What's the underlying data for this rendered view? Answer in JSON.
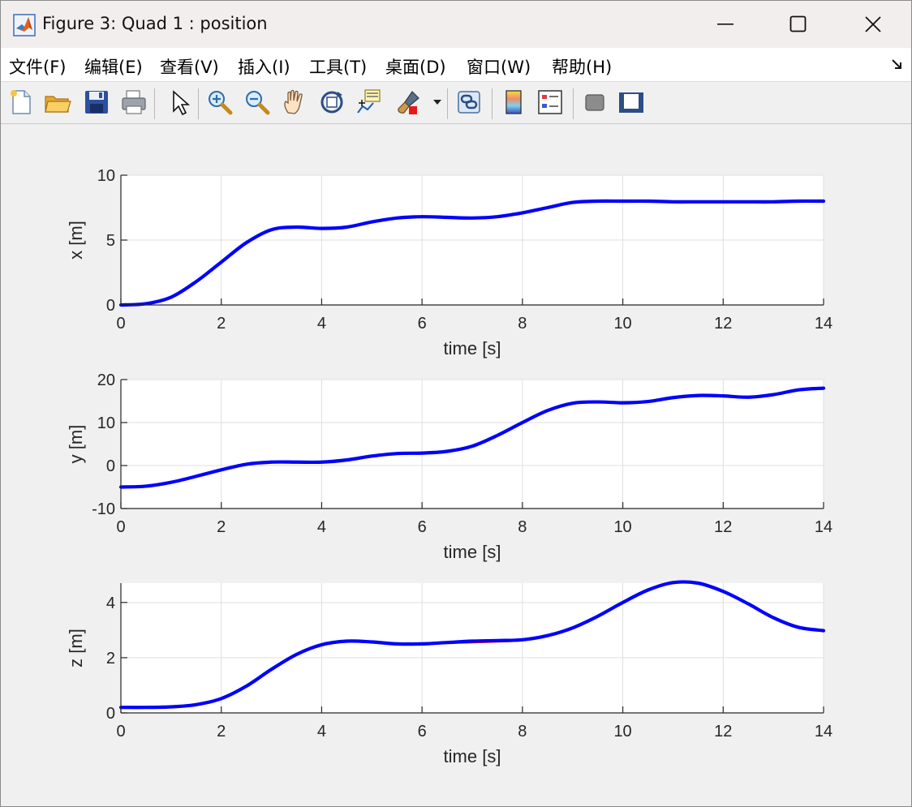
{
  "window": {
    "title": "Figure 3: Quad 1 : position",
    "app_icon": "matlab-logo-icon"
  },
  "menubar": {
    "items": [
      "文件(F)",
      "编辑(E)",
      "查看(V)",
      "插入(I)",
      "工具(T)",
      "桌面(D)",
      "窗口(W)",
      "帮助(H)"
    ]
  },
  "toolbar": {
    "buttons": [
      "new-figure-icon",
      "open-file-icon",
      "save-icon",
      "print-icon",
      "edit-plot-arrow-icon",
      "zoom-in-icon",
      "zoom-out-icon",
      "pan-hand-icon",
      "rotate-3d-icon",
      "data-cursor-icon",
      "brush-icon",
      "brush-dropdown-icon",
      "link-plot-icon",
      "colorbar-icon",
      "legend-icon",
      "hide-plot-tools-icon",
      "show-plot-tools-icon"
    ]
  },
  "colors": {
    "line_main": "#0000ff",
    "line_ref": "#ff0000",
    "axes_bg": "#ffffff",
    "figure_bg": "#f0f0f0"
  },
  "chart_data": [
    {
      "type": "line",
      "xlabel": "time [s]",
      "ylabel": "x [m]",
      "xlim": [
        0,
        14
      ],
      "ylim": [
        0,
        10
      ],
      "xticks": [
        "0",
        "2",
        "4",
        "6",
        "8",
        "10",
        "12",
        "14"
      ],
      "yticks": [
        "0",
        "5",
        "10"
      ],
      "grid": true,
      "series": [
        {
          "color": "#0000ff",
          "x": [
            0,
            0.5,
            1,
            1.5,
            2,
            2.5,
            3,
            3.5,
            4,
            4.5,
            5,
            5.5,
            6,
            6.5,
            7,
            7.5,
            8,
            8.5,
            9,
            9.5,
            10,
            10.5,
            11,
            11.5,
            12,
            12.5,
            13,
            13.5,
            14
          ],
          "y": [
            0,
            0.1,
            0.6,
            1.8,
            3.3,
            4.8,
            5.8,
            6.0,
            5.9,
            6.0,
            6.4,
            6.7,
            6.8,
            6.75,
            6.7,
            6.8,
            7.1,
            7.5,
            7.9,
            8.0,
            8.0,
            8.0,
            7.95,
            7.95,
            7.95,
            7.95,
            7.95,
            8.0,
            8.0
          ]
        }
      ]
    },
    {
      "type": "line",
      "xlabel": "time [s]",
      "ylabel": "y [m]",
      "xlim": [
        0,
        14
      ],
      "ylim": [
        -10,
        20
      ],
      "xticks": [
        "0",
        "2",
        "4",
        "6",
        "8",
        "10",
        "12",
        "14"
      ],
      "yticks": [
        "-10",
        "0",
        "10",
        "20"
      ],
      "grid": true,
      "series": [
        {
          "color": "#0000ff",
          "x": [
            0,
            0.5,
            1,
            1.5,
            2,
            2.5,
            3,
            3.5,
            4,
            4.5,
            5,
            5.5,
            6,
            6.5,
            7,
            7.5,
            8,
            8.5,
            9,
            9.5,
            10,
            10.5,
            11,
            11.5,
            12,
            12.5,
            13,
            13.5,
            14
          ],
          "y": [
            -5,
            -4.8,
            -3.9,
            -2.5,
            -1,
            0.3,
            0.8,
            0.8,
            0.8,
            1.3,
            2.2,
            2.8,
            2.9,
            3.3,
            4.5,
            7.0,
            10.0,
            12.8,
            14.5,
            14.8,
            14.6,
            14.9,
            15.8,
            16.3,
            16.2,
            15.9,
            16.5,
            17.6,
            18.0
          ]
        }
      ]
    },
    {
      "type": "line",
      "xlabel": "time [s]",
      "ylabel": "z [m]",
      "xlim": [
        0,
        14
      ],
      "ylim": [
        0,
        4.7
      ],
      "xticks": [
        "0",
        "2",
        "4",
        "6",
        "8",
        "10",
        "12",
        "14"
      ],
      "yticks": [
        "0",
        "2",
        "4"
      ],
      "grid": true,
      "series": [
        {
          "color": "#ff0000",
          "x": [
            0,
            0.5,
            1,
            1.5,
            2,
            2.5,
            3,
            3.5,
            4,
            4.5,
            5,
            5.5,
            6,
            6.5,
            7,
            7.5,
            8,
            8.5,
            9,
            9.5,
            10,
            10.5,
            11,
            11.5,
            12,
            12.5,
            13,
            13.5,
            14
          ],
          "y": [
            0.2,
            0.2,
            0.2,
            0.28,
            0.5,
            0.95,
            1.55,
            2.1,
            2.45,
            2.6,
            2.58,
            2.52,
            2.5,
            2.53,
            2.55,
            2.58,
            2.63,
            2.78,
            3.05,
            3.5,
            4.0,
            4.45,
            4.7,
            4.7,
            4.4,
            3.95,
            3.45,
            3.1,
            2.98
          ]
        },
        {
          "color": "#0000ff",
          "x": [
            0,
            0.5,
            1,
            1.5,
            2,
            2.5,
            3,
            3.5,
            4,
            4.5,
            5,
            5.5,
            6,
            6.5,
            7,
            7.5,
            8,
            8.5,
            9,
            9.5,
            10,
            10.5,
            11,
            11.5,
            12,
            12.5,
            13,
            13.5,
            14
          ],
          "y": [
            0.2,
            0.2,
            0.22,
            0.3,
            0.52,
            0.97,
            1.58,
            2.12,
            2.47,
            2.6,
            2.57,
            2.5,
            2.5,
            2.55,
            2.6,
            2.62,
            2.65,
            2.8,
            3.08,
            3.5,
            4.0,
            4.45,
            4.72,
            4.7,
            4.4,
            3.95,
            3.45,
            3.1,
            2.98
          ]
        }
      ]
    }
  ]
}
